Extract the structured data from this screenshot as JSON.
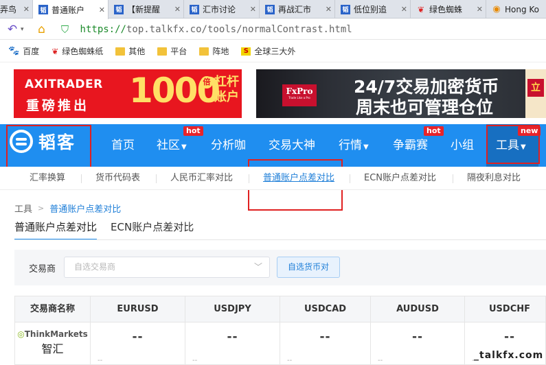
{
  "browser": {
    "tabs": [
      {
        "title": "弄鸟",
        "icon": "page-icon",
        "active": false
      },
      {
        "title": "普通账户",
        "icon": "talkfx-icon",
        "active": true
      },
      {
        "title": "【新提醒",
        "icon": "talkfx-icon",
        "active": false
      },
      {
        "title": "汇市讨论",
        "icon": "talkfx-icon",
        "active": false
      },
      {
        "title": "再战汇市",
        "icon": "talkfx-icon",
        "active": false
      },
      {
        "title": "低位别追",
        "icon": "talkfx-icon",
        "active": false
      },
      {
        "title": "绿色蜘蛛",
        "icon": "bug-icon",
        "active": false
      },
      {
        "title": "Hong Ko",
        "icon": "globe-icon",
        "active": false
      }
    ],
    "url_scheme": "https://",
    "url_rest": "top.talkfx.co/tools/normalContrast.html",
    "bookmarks": [
      {
        "label": "百度",
        "icon": "paw-icon"
      },
      {
        "label": "绿色蜘蛛纸",
        "icon": "bug-icon"
      },
      {
        "label": "其他",
        "icon": "folder-icon"
      },
      {
        "label": "平台",
        "icon": "folder-icon"
      },
      {
        "label": "阵地",
        "icon": "folder-icon"
      },
      {
        "label": "全球三大外",
        "icon": "s-icon"
      }
    ]
  },
  "ads": {
    "left": {
      "brand": "AXITRADER",
      "slogan": "重磅推出",
      "big": "1000",
      "bei": "倍",
      "lev": "杠杆账户"
    },
    "right": {
      "brand": "FxPro",
      "tagline": "Trade Like a Pro",
      "head1": "24/7交易加密货币",
      "head2": "周末也可管理仓位",
      "side": "立"
    }
  },
  "site": {
    "logo_text": "韬客",
    "nav": [
      {
        "label": "首页",
        "caret": false,
        "badge": ""
      },
      {
        "label": "社区",
        "caret": true,
        "badge": "hot"
      },
      {
        "label": "分析咖",
        "caret": false,
        "badge": ""
      },
      {
        "label": "交易大神",
        "caret": false,
        "badge": ""
      },
      {
        "label": "行情",
        "caret": true,
        "badge": ""
      },
      {
        "label": "争霸赛",
        "caret": false,
        "badge": "hot"
      },
      {
        "label": "小组",
        "caret": false,
        "badge": ""
      },
      {
        "label": "工具",
        "caret": true,
        "badge": "new"
      }
    ],
    "subnav": [
      "汇率换算",
      "货币代码表",
      "人民币汇率对比",
      "普通账户点差对比",
      "ECN账户点差对比",
      "隔夜利息对比"
    ],
    "subnav_active": "普通账户点差对比"
  },
  "main": {
    "breadcrumb": [
      "工具",
      "普通账户点差对比"
    ],
    "tabs": [
      "普通账户点差对比",
      "ECN账户点差对比"
    ],
    "filter": {
      "label": "交易商",
      "placeholder": "自选交易商",
      "button": "自选货币对"
    },
    "table": {
      "headers": [
        "交易商名称",
        "EURUSD",
        "USDJPY",
        "USDCAD",
        "AUDUSD",
        "USDCHF"
      ],
      "row": {
        "broker_en": "ThinkMarkets",
        "broker_cn": "智汇",
        "values": [
          "--",
          "--",
          "--",
          "--",
          "--"
        ],
        "sub": "--"
      }
    }
  },
  "watermark": "_talkfx.com",
  "colors": {
    "brand_blue": "#1f8ef0",
    "active_blue": "#176fc1",
    "hot_red": "#e8232a",
    "highlight_red": "#e02020"
  }
}
